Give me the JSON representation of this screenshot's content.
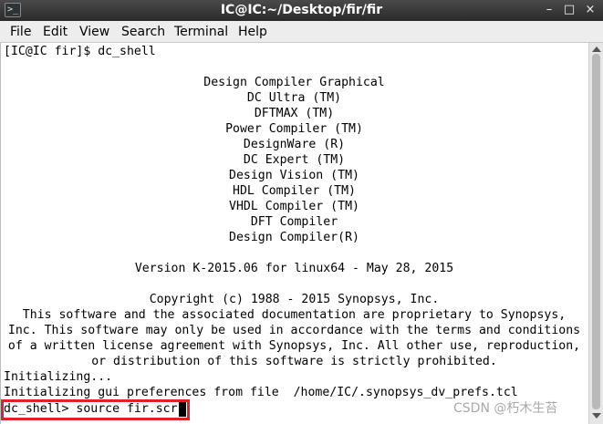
{
  "window": {
    "title": "IC@IC:~/Desktop/fir/fir",
    "icon": "terminal-icon",
    "icon_glyph": ">_",
    "controls": {
      "minimize": "–",
      "maximize": "□",
      "close": "×"
    }
  },
  "menu": {
    "items": [
      "File",
      "Edit",
      "View",
      "Search",
      "Terminal",
      "Help"
    ]
  },
  "terminal": {
    "lines": [
      "[IC@IC fir]$ dc_shell",
      "",
      "Design Compiler Graphical",
      "DC Ultra (TM)",
      "DFTMAX (TM)",
      "Power Compiler (TM)",
      "DesignWare (R)",
      "DC Expert (TM)",
      "Design Vision (TM)",
      "HDL Compiler (TM)",
      "VHDL Compiler (TM)",
      "DFT Compiler",
      "Design Compiler(R)",
      "",
      "Version K-2015.06 for linux64 - May 28, 2015",
      "",
      "Copyright (c) 1988 - 2015 Synopsys, Inc.",
      "This software and the associated documentation are proprietary to Synopsys,",
      "Inc. This software may only be used in accordance with the terms and conditions",
      "of a written license agreement with Synopsys, Inc. All other use, reproduction,",
      "or distribution of this software is strictly prohibited.",
      "Initializing...",
      "Initializing gui preferences from file  /home/IC/.synopsys_dv_prefs.tcl",
      "dc_shell> source fir.scr"
    ],
    "highlight_color": "#e0202a"
  },
  "watermark": "CSDN @朽木生苔"
}
